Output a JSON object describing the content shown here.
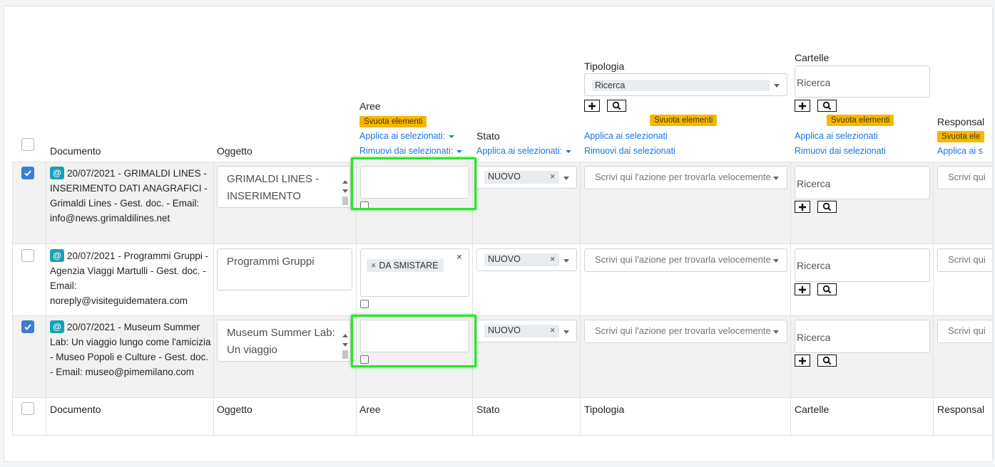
{
  "columns": {
    "documento": "Documento",
    "oggetto": "Oggetto",
    "aree": "Aree",
    "stato": "Stato",
    "tipologia": "Tipologia",
    "cartelle": "Cartelle",
    "responsabili": "Responsal"
  },
  "header": {
    "svuota": "Svuota elementi",
    "applica_dd": "Applica ai selezionati:",
    "rimuovi_dd": "Rimuovi dai selezionati:",
    "applica": "Applica ai selezionati",
    "rimuovi": "Rimuovi dai selezionati",
    "applica_trunc": "Applica ai s",
    "svuota_trunc": "Svuota ele",
    "tipologia_search": "Ricerca",
    "cartelle_search": "Ricerca"
  },
  "rows": [
    {
      "checked": true,
      "at": "@",
      "document": "20/07/2021 - GRIMALDI LINES - INSERIMENTO DATI ANAGRAFICI - Grimaldi Lines - Gest. doc. - Email: info@news.grimaldilines.net",
      "oggetto": "GRIMALDI LINES - INSERIMENTO",
      "aree_tag": "",
      "stato": "NUOVO",
      "tipologia_placeholder": "Scrivi qui l'azione per trovarla velocemente",
      "cartelle_search": "Ricerca",
      "resp_placeholder": "Scrivi qui"
    },
    {
      "checked": false,
      "at": "@",
      "document": "20/07/2021 - Programmi Gruppi - Agenzia Viaggi Martulli - Gest. doc. - Email: noreply@visiteguidematera.com",
      "oggetto": "Programmi Gruppi",
      "aree_tag": "DA SMISTARE",
      "stato": "NUOVO",
      "tipologia_placeholder": "Scrivi qui l'azione per trovarla velocemente",
      "cartelle_search": "Ricerca",
      "resp_placeholder": "Scrivi qui"
    },
    {
      "checked": true,
      "at": "@",
      "document": "20/07/2021 - Museum Summer Lab: Un viaggio lungo come l'amicizia - Museo Popoli e Culture - Gest. doc. - Email: museo@pimemilano.com",
      "oggetto": "Museum Summer Lab: Un viaggio",
      "aree_tag": "",
      "stato": "NUOVO",
      "tipologia_placeholder": "Scrivi qui l'azione per trovarla velocemente",
      "cartelle_search": "Ricerca",
      "resp_placeholder": "Scrivi qui"
    }
  ],
  "glyphs": {
    "remove": "×"
  },
  "colors": {
    "accent": "#3b7fd1",
    "link": "#1a73e8",
    "badge": "#f5b800",
    "highlight": "#27e827",
    "badge_info": "#17a2b8"
  }
}
